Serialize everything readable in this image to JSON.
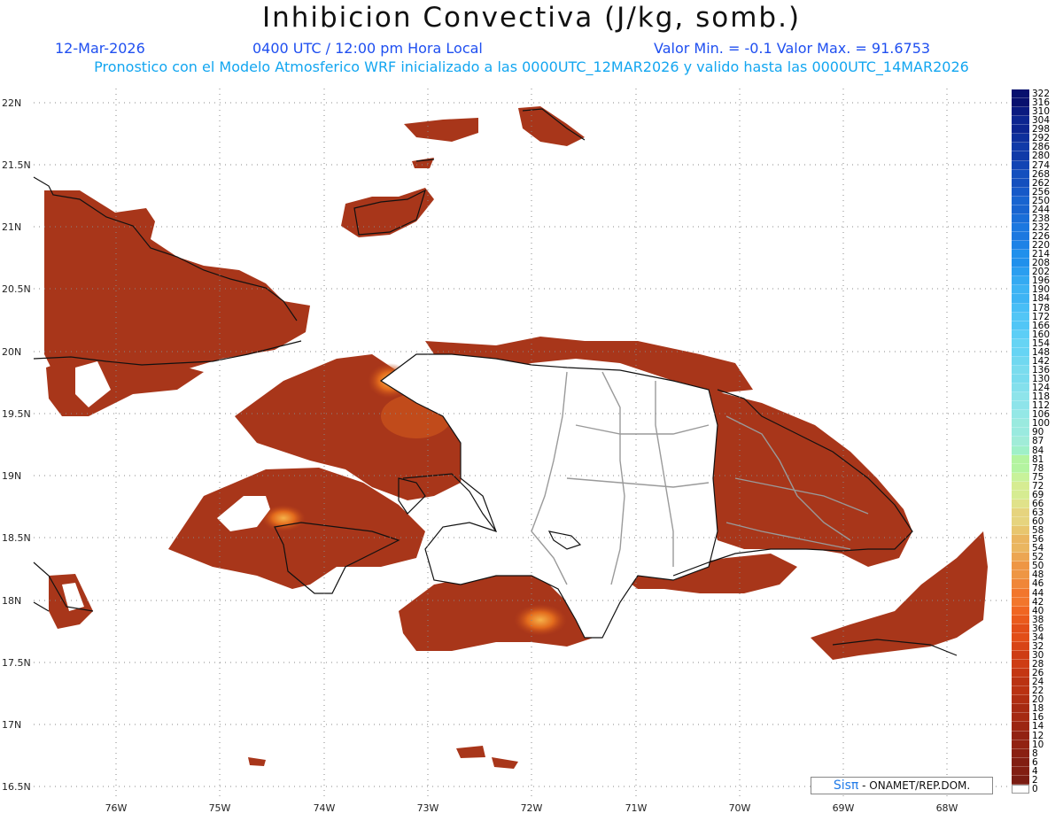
{
  "header": {
    "title": "Inhibicion Convectiva (J/kg, somb.)",
    "date": "12-Mar-2026",
    "time": "0400 UTC / 12:00 pm Hora Local",
    "minmax": "Valor Min. = -0.1  Valor Max. = 91.6753",
    "model": "Pronostico con el Modelo Atmosferico WRF inicializado a las 0000UTC_12MAR2026 y valido hasta las  0000UTC_14MAR2026"
  },
  "map": {
    "lat_labels": [
      "22N",
      "21.5N",
      "21N",
      "20.5N",
      "20N",
      "19.5N",
      "19N",
      "18.5N",
      "18N",
      "17.5N",
      "17N",
      "16.5N"
    ],
    "lon_labels": [
      "76W",
      "75W",
      "74W",
      "73W",
      "72W",
      "71W",
      "70W",
      "69W",
      "68W"
    ],
    "fill_colors": {
      "low": "#8a2414",
      "mid": "#b8401a",
      "high": "#e86a1a",
      "peak": "#f6b24a"
    }
  },
  "legend": {
    "labels": [
      "322",
      "316",
      "310",
      "304",
      "298",
      "292",
      "286",
      "280",
      "274",
      "268",
      "262",
      "256",
      "250",
      "244",
      "238",
      "232",
      "226",
      "220",
      "214",
      "208",
      "202",
      "196",
      "190",
      "184",
      "178",
      "172",
      "166",
      "160",
      "154",
      "148",
      "142",
      "136",
      "130",
      "124",
      "118",
      "112",
      "106",
      "100",
      "90",
      "87",
      "84",
      "81",
      "78",
      "75",
      "72",
      "69",
      "66",
      "63",
      "60",
      "58",
      "56",
      "54",
      "52",
      "50",
      "48",
      "46",
      "44",
      "42",
      "40",
      "38",
      "36",
      "34",
      "32",
      "30",
      "28",
      "26",
      "24",
      "22",
      "20",
      "18",
      "16",
      "14",
      "12",
      "10",
      "8",
      "6",
      "4",
      "2",
      "0"
    ],
    "colors": [
      "#08106e",
      "#0a1a80",
      "#0c2590",
      "#0e309c",
      "#103aa8",
      "#1244b4",
      "#144fbe",
      "#1659c8",
      "#1864d0",
      "#1a6ed8",
      "#1c78e0",
      "#1e82e6",
      "#2090ec",
      "#2a9ef0",
      "#34aaf2",
      "#3eb4f4",
      "#48bef6",
      "#52c6f6",
      "#5ccef6",
      "#66d4f4",
      "#70d8f0",
      "#7adcee",
      "#84e0ec",
      "#8ee4ea",
      "#94e8e6",
      "#9aeadf",
      "#a0ecd8",
      "#9ff0c8",
      "#b4f4a0",
      "#c8f29a",
      "#d6ec92",
      "#e0e28a",
      "#e6d47e",
      "#e8c66e",
      "#eab660",
      "#eca652",
      "#ee9644",
      "#f08638",
      "#f2762c",
      "#f06622",
      "#ea5a1c",
      "#e24e18",
      "#d84416",
      "#ce3c14",
      "#c43612",
      "#ba3212",
      "#b02e12",
      "#a62a12",
      "#9c2612",
      "#922212",
      "#8a2012",
      "#821e12",
      "#7a1c12",
      "#fff"
    ]
  },
  "credit": {
    "brand": "Sisπ",
    "org": "- ONAMET/REP.DOM."
  }
}
